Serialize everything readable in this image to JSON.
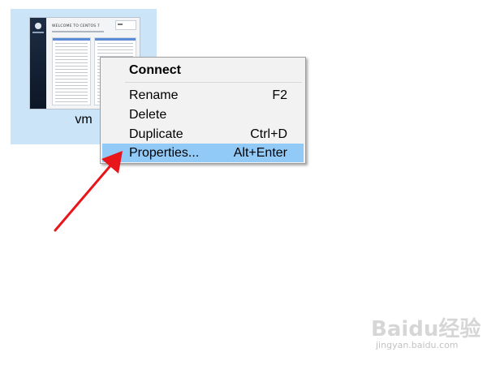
{
  "vm": {
    "name": "vm",
    "thumbnail": {
      "title": "WELCOME TO CENTOS 7"
    }
  },
  "context_menu": {
    "items": [
      {
        "label": "Connect",
        "shortcut": ""
      },
      {
        "label": "Rename",
        "shortcut": "F2"
      },
      {
        "label": "Delete",
        "shortcut": ""
      },
      {
        "label": "Duplicate",
        "shortcut": "Ctrl+D"
      },
      {
        "label": "Properties...",
        "shortcut": "Alt+Enter"
      }
    ],
    "highlighted_item": "Properties..."
  },
  "watermark": {
    "logo": "Baidu经验",
    "url": "jingyan.baidu.com"
  },
  "colors": {
    "tile_bg": "#cce4f7",
    "menu_bg": "#f2f2f2",
    "highlight": "#91c9f7",
    "arrow": "#e8161a"
  }
}
